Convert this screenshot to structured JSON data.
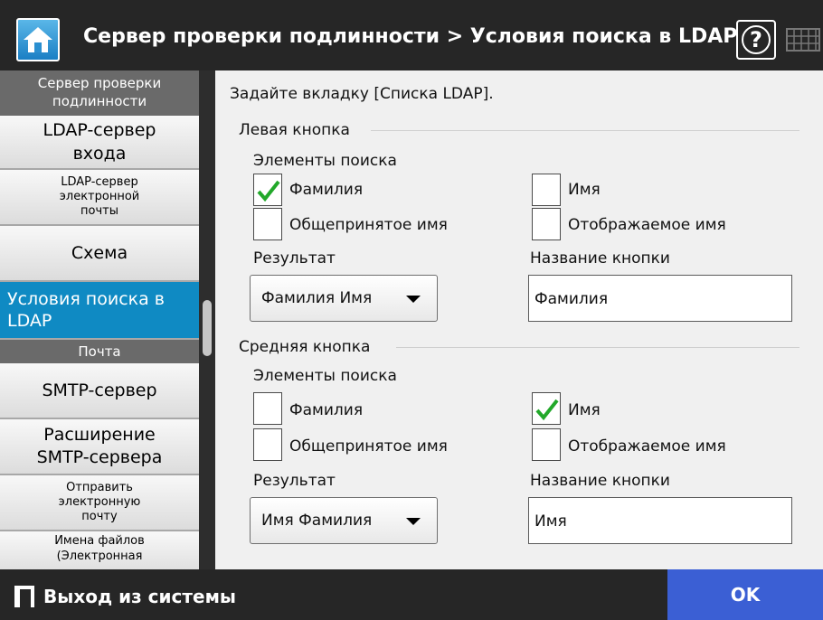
{
  "header": {
    "title": "Сервер проверки подлинности > Условия поиска в LDAP",
    "home_icon": "home-icon",
    "help_label": "?",
    "keyboard_icon": "keyboard-icon"
  },
  "sidebar": {
    "section1": "Сервер проверки подлинности",
    "item_ldap_login": "LDAP-сервер входа",
    "item_ldap_email": "LDAP-сервер электронной почты",
    "item_schema": "Схема",
    "item_search": "Условия поиска в LDAP",
    "section2": "Почта",
    "item_smtp": "SMTP-сервер",
    "item_smtp_ext": "Расширение SMTP-сервера",
    "item_send": "Отправить электронную почту",
    "item_filenames": "Имена файлов (Электронная"
  },
  "main": {
    "instruction": "Задайте вкладку [Списка LDAP].",
    "left": {
      "heading": "Левая кнопка",
      "search_items": "Элементы поиска",
      "cb_surname": "Фамилия",
      "cb_surname_checked": true,
      "cb_name": "Имя",
      "cb_name_checked": false,
      "cb_common": "Общепринятое имя",
      "cb_common_checked": false,
      "cb_display": "Отображаемое имя",
      "cb_display_checked": false,
      "result_label": "Результат",
      "result_value": "Фамилия Имя",
      "button_name_label": "Название кнопки",
      "button_name_value": "Фамилия"
    },
    "middle": {
      "heading": "Средняя кнопка",
      "search_items": "Элементы поиска",
      "cb_surname": "Фамилия",
      "cb_surname_checked": false,
      "cb_name": "Имя",
      "cb_name_checked": true,
      "cb_common": "Общепринятое имя",
      "cb_common_checked": false,
      "cb_display": "Отображаемое имя",
      "cb_display_checked": false,
      "result_label": "Результат",
      "result_value": "Имя Фамилия",
      "button_name_label": "Название кнопки",
      "button_name_value": "Имя"
    }
  },
  "footer": {
    "logout": "Выход из системы",
    "ok": "OK"
  },
  "colors": {
    "header_bg": "#262626",
    "active_nav": "#0f8ac3",
    "ok_button": "#3b5fd4",
    "check_green": "#22a82a"
  }
}
